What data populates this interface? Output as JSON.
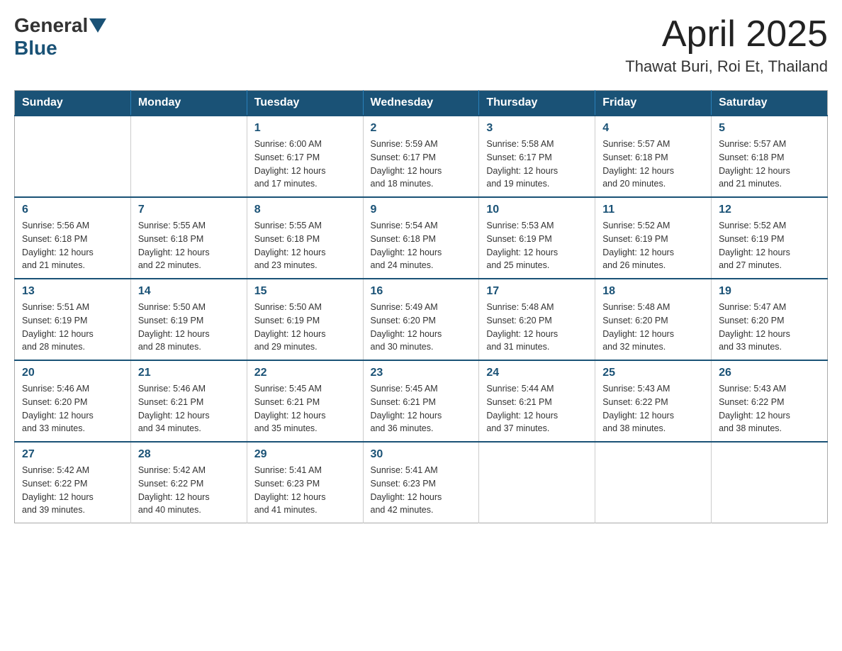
{
  "header": {
    "logo_general": "General",
    "logo_blue": "Blue",
    "title": "April 2025",
    "location": "Thawat Buri, Roi Et, Thailand"
  },
  "weekdays": [
    "Sunday",
    "Monday",
    "Tuesday",
    "Wednesday",
    "Thursday",
    "Friday",
    "Saturday"
  ],
  "weeks": [
    [
      {
        "day": "",
        "info": ""
      },
      {
        "day": "",
        "info": ""
      },
      {
        "day": "1",
        "info": "Sunrise: 6:00 AM\nSunset: 6:17 PM\nDaylight: 12 hours\nand 17 minutes."
      },
      {
        "day": "2",
        "info": "Sunrise: 5:59 AM\nSunset: 6:17 PM\nDaylight: 12 hours\nand 18 minutes."
      },
      {
        "day": "3",
        "info": "Sunrise: 5:58 AM\nSunset: 6:17 PM\nDaylight: 12 hours\nand 19 minutes."
      },
      {
        "day": "4",
        "info": "Sunrise: 5:57 AM\nSunset: 6:18 PM\nDaylight: 12 hours\nand 20 minutes."
      },
      {
        "day": "5",
        "info": "Sunrise: 5:57 AM\nSunset: 6:18 PM\nDaylight: 12 hours\nand 21 minutes."
      }
    ],
    [
      {
        "day": "6",
        "info": "Sunrise: 5:56 AM\nSunset: 6:18 PM\nDaylight: 12 hours\nand 21 minutes."
      },
      {
        "day": "7",
        "info": "Sunrise: 5:55 AM\nSunset: 6:18 PM\nDaylight: 12 hours\nand 22 minutes."
      },
      {
        "day": "8",
        "info": "Sunrise: 5:55 AM\nSunset: 6:18 PM\nDaylight: 12 hours\nand 23 minutes."
      },
      {
        "day": "9",
        "info": "Sunrise: 5:54 AM\nSunset: 6:18 PM\nDaylight: 12 hours\nand 24 minutes."
      },
      {
        "day": "10",
        "info": "Sunrise: 5:53 AM\nSunset: 6:19 PM\nDaylight: 12 hours\nand 25 minutes."
      },
      {
        "day": "11",
        "info": "Sunrise: 5:52 AM\nSunset: 6:19 PM\nDaylight: 12 hours\nand 26 minutes."
      },
      {
        "day": "12",
        "info": "Sunrise: 5:52 AM\nSunset: 6:19 PM\nDaylight: 12 hours\nand 27 minutes."
      }
    ],
    [
      {
        "day": "13",
        "info": "Sunrise: 5:51 AM\nSunset: 6:19 PM\nDaylight: 12 hours\nand 28 minutes."
      },
      {
        "day": "14",
        "info": "Sunrise: 5:50 AM\nSunset: 6:19 PM\nDaylight: 12 hours\nand 28 minutes."
      },
      {
        "day": "15",
        "info": "Sunrise: 5:50 AM\nSunset: 6:19 PM\nDaylight: 12 hours\nand 29 minutes."
      },
      {
        "day": "16",
        "info": "Sunrise: 5:49 AM\nSunset: 6:20 PM\nDaylight: 12 hours\nand 30 minutes."
      },
      {
        "day": "17",
        "info": "Sunrise: 5:48 AM\nSunset: 6:20 PM\nDaylight: 12 hours\nand 31 minutes."
      },
      {
        "day": "18",
        "info": "Sunrise: 5:48 AM\nSunset: 6:20 PM\nDaylight: 12 hours\nand 32 minutes."
      },
      {
        "day": "19",
        "info": "Sunrise: 5:47 AM\nSunset: 6:20 PM\nDaylight: 12 hours\nand 33 minutes."
      }
    ],
    [
      {
        "day": "20",
        "info": "Sunrise: 5:46 AM\nSunset: 6:20 PM\nDaylight: 12 hours\nand 33 minutes."
      },
      {
        "day": "21",
        "info": "Sunrise: 5:46 AM\nSunset: 6:21 PM\nDaylight: 12 hours\nand 34 minutes."
      },
      {
        "day": "22",
        "info": "Sunrise: 5:45 AM\nSunset: 6:21 PM\nDaylight: 12 hours\nand 35 minutes."
      },
      {
        "day": "23",
        "info": "Sunrise: 5:45 AM\nSunset: 6:21 PM\nDaylight: 12 hours\nand 36 minutes."
      },
      {
        "day": "24",
        "info": "Sunrise: 5:44 AM\nSunset: 6:21 PM\nDaylight: 12 hours\nand 37 minutes."
      },
      {
        "day": "25",
        "info": "Sunrise: 5:43 AM\nSunset: 6:22 PM\nDaylight: 12 hours\nand 38 minutes."
      },
      {
        "day": "26",
        "info": "Sunrise: 5:43 AM\nSunset: 6:22 PM\nDaylight: 12 hours\nand 38 minutes."
      }
    ],
    [
      {
        "day": "27",
        "info": "Sunrise: 5:42 AM\nSunset: 6:22 PM\nDaylight: 12 hours\nand 39 minutes."
      },
      {
        "day": "28",
        "info": "Sunrise: 5:42 AM\nSunset: 6:22 PM\nDaylight: 12 hours\nand 40 minutes."
      },
      {
        "day": "29",
        "info": "Sunrise: 5:41 AM\nSunset: 6:23 PM\nDaylight: 12 hours\nand 41 minutes."
      },
      {
        "day": "30",
        "info": "Sunrise: 5:41 AM\nSunset: 6:23 PM\nDaylight: 12 hours\nand 42 minutes."
      },
      {
        "day": "",
        "info": ""
      },
      {
        "day": "",
        "info": ""
      },
      {
        "day": "",
        "info": ""
      }
    ]
  ]
}
